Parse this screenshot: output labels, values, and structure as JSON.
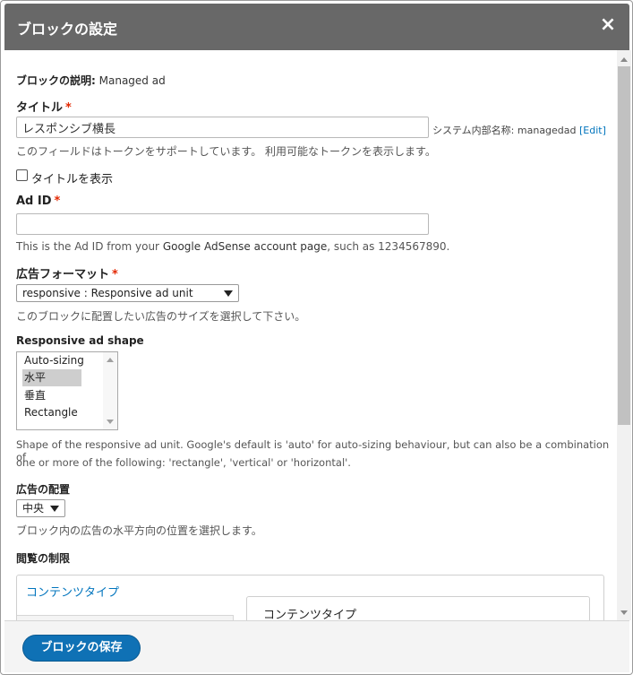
{
  "dialog": {
    "title": "ブロックの設定",
    "close_glyph": "×"
  },
  "block_description": {
    "label": "ブロックの説明:",
    "value": "Managed ad"
  },
  "title_field": {
    "label": "タイトル",
    "required_mark": "*",
    "value": "レスポンシブ横長",
    "machine_name_label": "システム内部名称:",
    "machine_name": "managedad",
    "edit_link": "[Edit]",
    "help": "このフィールドはトークンをサポートしています。 利用可能なトークンを表示します。"
  },
  "display_title": {
    "label": "タイトルを表示",
    "checked": false
  },
  "ad_id": {
    "label": "Ad ID",
    "required_mark": "*",
    "value": "",
    "help_prefix": "This is the Ad ID from your",
    "help_link": "Google AdSense account page",
    "help_suffix": ", such as 1234567890."
  },
  "ad_format": {
    "label": "広告フォーマット",
    "required_mark": "*",
    "selected": "responsive : Responsive ad unit",
    "help": "このブロックに配置したい広告のサイズを選択して下さい。"
  },
  "ad_shape": {
    "label": "Responsive ad shape",
    "options": [
      {
        "label": "Auto-sizing",
        "selected": false
      },
      {
        "label": "水平",
        "selected": true
      },
      {
        "label": "垂直",
        "selected": false
      },
      {
        "label": "Rectangle",
        "selected": false
      }
    ],
    "help_line1": "Shape of the responsive ad unit. Google's default is 'auto' for auto-sizing behaviour, but can also be a combination of",
    "help_line2": "one or more of the following: 'rectangle', 'vertical' or 'horizontal'."
  },
  "alignment": {
    "label": "広告の配置",
    "selected": "中央",
    "help": "ブロック内の広告の水平方向の位置を選択します。"
  },
  "visibility": {
    "label": "閲覧の制限",
    "tab_label": "コンテンツタイプ",
    "section_title": "コンテンツタイプ"
  },
  "footer": {
    "save_label": "ブロックの保存"
  },
  "colors": {
    "titlebar": "#686868",
    "primary_button": "#0f71b5",
    "link": "#0074bd",
    "required": "#e32700"
  }
}
